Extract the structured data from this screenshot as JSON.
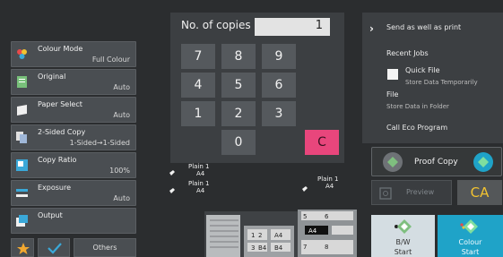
{
  "settings": [
    {
      "name": "Colour Mode",
      "value": "Full Colour"
    },
    {
      "name": "Original",
      "value": "Auto"
    },
    {
      "name": "Paper Select",
      "value": "Auto"
    },
    {
      "name": "2-Sided Copy",
      "value": "1-Sided→1-Sided"
    },
    {
      "name": "Copy Ratio",
      "value": "100%"
    },
    {
      "name": "Exposure",
      "value": "Auto"
    },
    {
      "name": "Output",
      "value": ""
    }
  ],
  "bottom": {
    "others_label": "Others"
  },
  "keypad": {
    "label": "No. of copies",
    "value": "1",
    "keys": [
      "7",
      "8",
      "9",
      "4",
      "5",
      "6",
      "1",
      "2",
      "3",
      "0",
      "C"
    ]
  },
  "right_panel": {
    "send_print": "Send as well as print",
    "recent_jobs": "Recent Jobs",
    "quick_file": "Quick File",
    "quick_file_sub": "Store Data Temporarily",
    "file": "File",
    "file_sub": "Store Data in Folder",
    "eco": "Call Eco Program"
  },
  "actions": {
    "proof_copy": "Proof Copy",
    "preview": "Preview",
    "ca": "CA",
    "bw_line1": "B/W",
    "bw_line2": "Start",
    "colour_line1": "Colour",
    "colour_line2": "Start"
  },
  "trays": [
    {
      "type": "Plain 1",
      "size": "A4"
    },
    {
      "type": "Plain 1",
      "size": "A4"
    },
    {
      "type": "Plain 1",
      "size": "A4"
    }
  ],
  "machine_labels": [
    "1",
    "2",
    "3",
    "B4",
    "A4",
    "B4",
    "A4",
    "5",
    "6",
    "7",
    "8"
  ],
  "colors": {
    "accent_teal": "#1fa3c8",
    "clear_key": "#e8467c",
    "ca_text": "#f2c230",
    "proof_green": "#7fbf7f"
  }
}
